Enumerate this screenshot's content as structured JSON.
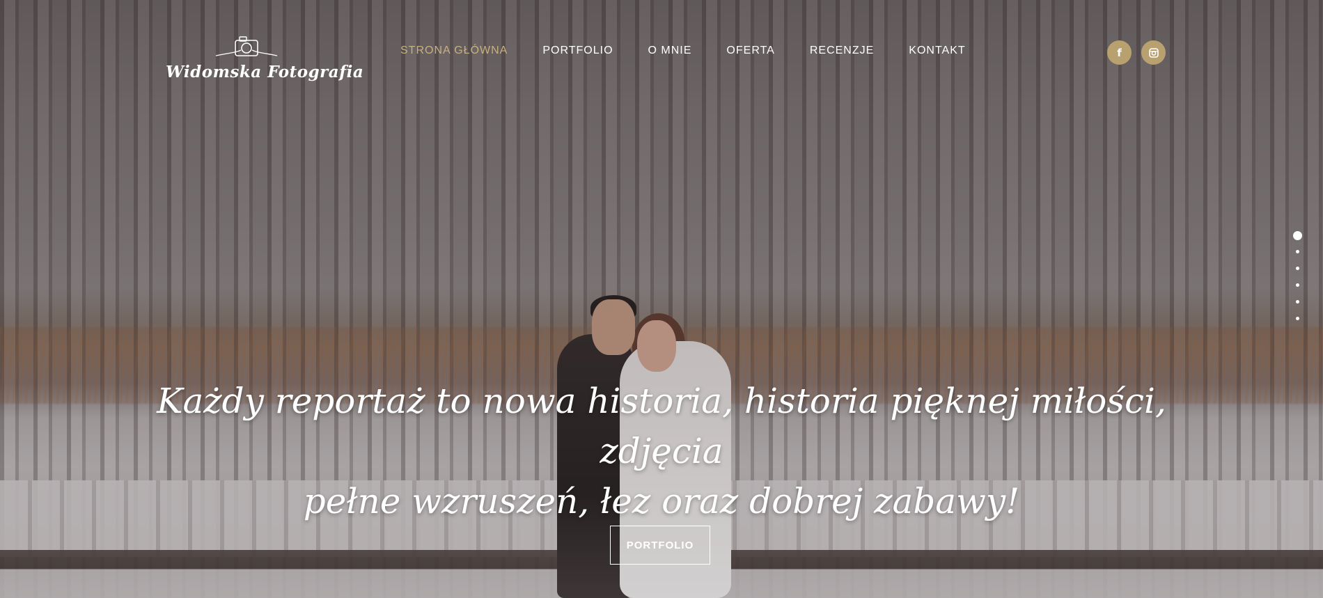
{
  "logo": {
    "text": "Widomska Fotografia"
  },
  "nav": {
    "items": [
      {
        "label": "STRONA GŁÓWNA",
        "active": true
      },
      {
        "label": "PORTFOLIO",
        "active": false
      },
      {
        "label": "O MNIE",
        "active": false
      },
      {
        "label": "OFERTA",
        "active": false
      },
      {
        "label": "RECENZJE",
        "active": false
      },
      {
        "label": "KONTAKT",
        "active": false
      }
    ]
  },
  "social": {
    "facebook_icon": "facebook-icon",
    "facebook_glyph": "f",
    "instagram_icon": "instagram-icon",
    "instagram_glyph": "◙"
  },
  "slider": {
    "total_slides": 6,
    "active_slide": 1
  },
  "hero": {
    "headline_line1": "Każdy reportaż to nowa historia, historia pięknej miłości, zdjęcia",
    "headline_line2": "pełne wzruszeń, łez oraz dobrej zabawy!",
    "cta_label": "PORTFOLIO"
  },
  "colors": {
    "accent": "#b8a06f",
    "active_nav": "#c9b07f",
    "text": "#ffffff"
  }
}
